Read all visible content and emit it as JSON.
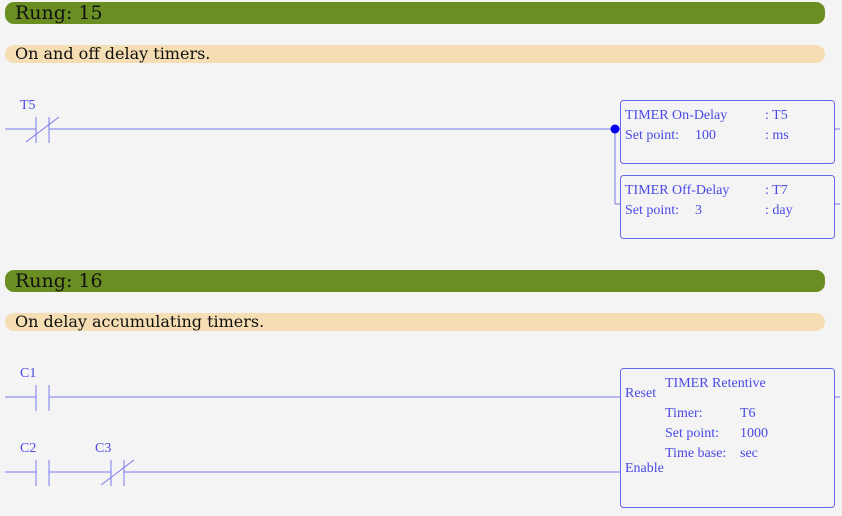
{
  "rungs": [
    {
      "title": "Rung: 15",
      "comment": "On and off delay timers.",
      "contacts": [
        {
          "label": "T5",
          "type": "normally-closed"
        }
      ],
      "blocks": [
        {
          "type": "TIMER On-Delay",
          "name": ": T5",
          "setpoint_label": "Set point:",
          "setpoint_value": "100",
          "unit": ": ms"
        },
        {
          "type": "TIMER Off-Delay",
          "name": ": T7",
          "setpoint_label": "Set point:",
          "setpoint_value": "3",
          "unit": ": day"
        }
      ]
    },
    {
      "title": "Rung: 16",
      "comment": "On delay accumulating timers.",
      "contacts": [
        {
          "label": "C1",
          "type": "normally-open"
        },
        {
          "label": "C2",
          "type": "normally-open"
        },
        {
          "label": "C3",
          "type": "normally-closed"
        }
      ],
      "block": {
        "type": "TIMER Retentive",
        "reset_label": "Reset",
        "enable_label": "Enable",
        "timer_label": "Timer:",
        "timer_value": "T6",
        "setpoint_label": "Set point:",
        "setpoint_value": "1000",
        "timebase_label": "Time base:",
        "timebase_value": "sec"
      }
    }
  ],
  "colors": {
    "header": "#6b8e23",
    "comment": "#f5deb3",
    "diagram": "#4a4ae6",
    "junction": "#0000ee"
  }
}
